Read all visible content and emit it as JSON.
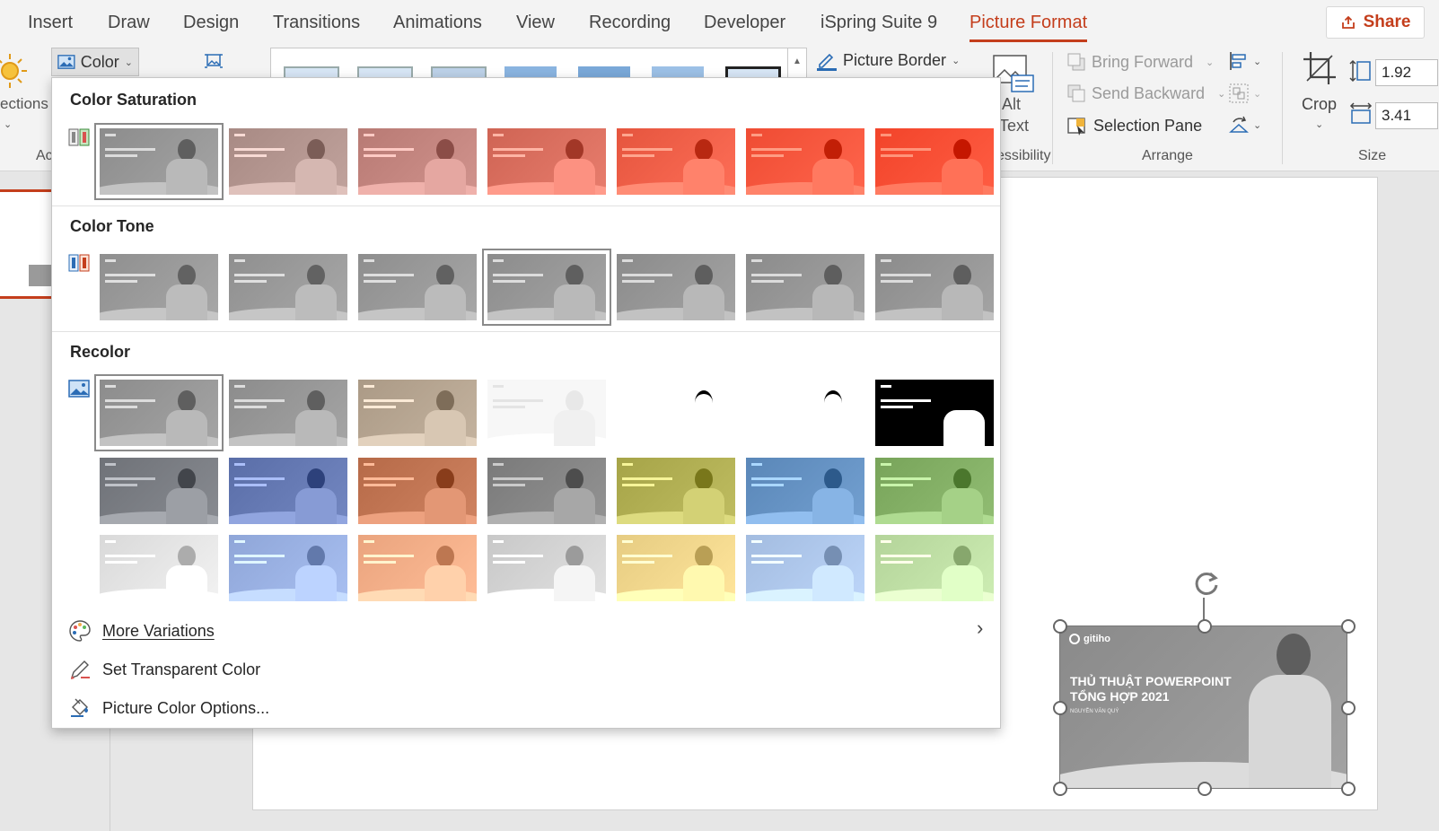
{
  "tabs": [
    "Insert",
    "Draw",
    "Design",
    "Transitions",
    "Animations",
    "View",
    "Recording",
    "Developer",
    "iSpring Suite 9",
    "Picture Format"
  ],
  "active_tab": "Picture Format",
  "share_label": "Share",
  "ribbon": {
    "corrections_label": "ections",
    "adjust_group_label": "Ac",
    "color_label": "Color",
    "picture_border_label": "Picture Border",
    "alt_text_line1": "Alt",
    "alt_text_line2": "Text",
    "accessibility_label": "essibility",
    "bring_forward_label": "Bring Forward",
    "send_backward_label": "Send Backward",
    "selection_pane_label": "Selection Pane",
    "arrange_label": "Arrange",
    "crop_label": "Crop",
    "size_label": "Size",
    "height_value": "1.92",
    "width_value": "3.41"
  },
  "menu": {
    "color_saturation_title": "Color Saturation",
    "color_tone_title": "Color Tone",
    "recolor_title": "Recolor",
    "more_variations_label": "More Variations",
    "set_transparent_label": "Set Transparent Color",
    "picture_color_options_label": "Picture Color Options...",
    "saturation_colors": [
      "#8c8c8c",
      "#a88a84",
      "#b87a74",
      "#cf6454",
      "#e5553e",
      "#ef4c33",
      "#f2442a"
    ],
    "tone_colors": [
      "#8f8f8f",
      "#8f8f8f",
      "#8e8e8e",
      "#8c8c8c",
      "#8b8b8b",
      "#8b8b8b",
      "#8b8b8b"
    ],
    "recolor_row1": [
      "#8c8c8c",
      "#8c8c8c",
      "#ab9a86",
      "#f4f4f4",
      "#ffffff",
      "#ffffff",
      "#000000"
    ],
    "recolor_row2": [
      "#6f7278",
      "#5a6ea8",
      "#b66a48",
      "#7a7a7a",
      "#a6a448",
      "#5a87b8",
      "#78a45a"
    ],
    "recolor_row3": [
      "#d9d9d9",
      "#8fa6d8",
      "#eaa47e",
      "#c8c8c8",
      "#e6cc82",
      "#a3bce0",
      "#b4d49a"
    ]
  },
  "selected_picture": {
    "brand": "gitiho",
    "title_line1": "THỦ THUẬT POWERPOINT",
    "title_line2": "TỔNG HỢP 2021",
    "author": "NGUYỄN VĂN QUÝ"
  }
}
